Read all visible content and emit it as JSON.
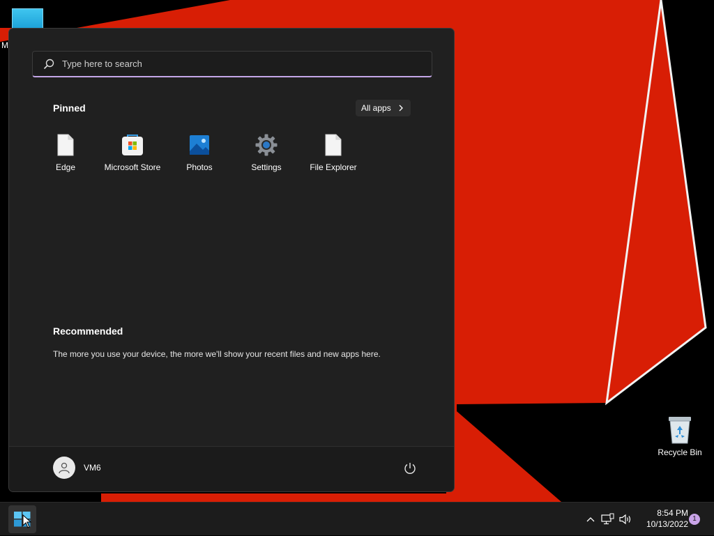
{
  "colors": {
    "wallpaper_red": "#d81e05",
    "menu_background": "#202020",
    "accent": "#c9a4e8",
    "taskbar_background": "#1c1c1c"
  },
  "desktop": {
    "partial_icon_label": "M",
    "recycle_bin": {
      "label": "Recycle Bin",
      "icon": "recycle-bin-icon"
    }
  },
  "start_menu": {
    "search": {
      "placeholder": "Type here to search",
      "value": "",
      "icon": "search-icon"
    },
    "pinned": {
      "title": "Pinned",
      "all_apps_label": "All apps",
      "apps": [
        {
          "label": "Edge",
          "icon": "file-icon"
        },
        {
          "label": "Microsoft Store",
          "icon": "store-icon"
        },
        {
          "label": "Photos",
          "icon": "photos-icon"
        },
        {
          "label": "Settings",
          "icon": "gear-icon"
        },
        {
          "label": "File Explorer",
          "icon": "file-icon"
        }
      ]
    },
    "recommended": {
      "title": "Recommended",
      "message": "The more you use your device, the more we'll show your recent files and new apps here."
    },
    "user": {
      "name": "VM6",
      "icon": "user-icon"
    },
    "power_icon": "power-icon"
  },
  "taskbar": {
    "start_icon": "windows-logo-icon",
    "tray_icons": [
      "chevron-up-icon",
      "network-icon",
      "speaker-icon"
    ],
    "time": "8:54 PM",
    "date": "10/13/2022",
    "notification_count": "1"
  }
}
